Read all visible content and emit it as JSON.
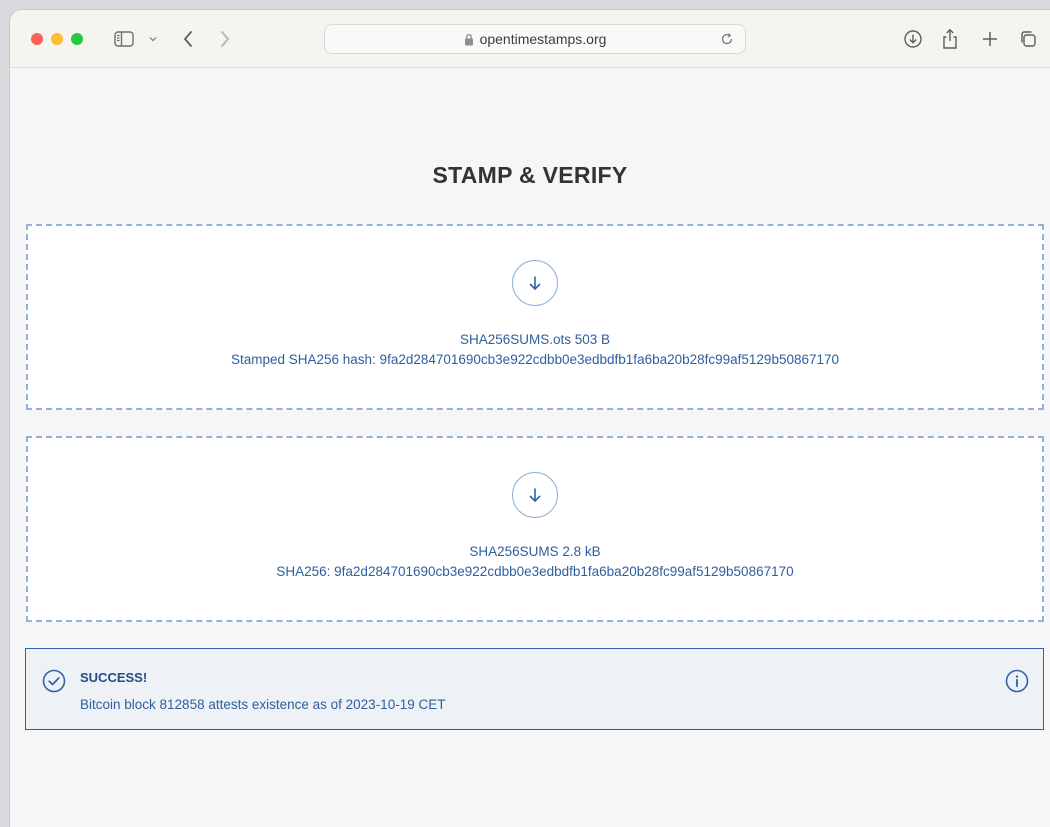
{
  "browser": {
    "url_host": "opentimestamps.org"
  },
  "page": {
    "title": "STAMP & VERIFY"
  },
  "dropzones": [
    {
      "line1": "SHA256SUMS.ots 503 B",
      "line2": "Stamped SHA256 hash: 9fa2d284701690cb3e922cdbb0e3edbdfb1fa6ba20b28fc99af5129b50867170"
    },
    {
      "line1": "SHA256SUMS 2.8 kB",
      "line2": "SHA256: 9fa2d284701690cb3e922cdbb0e3edbdfb1fa6ba20b28fc99af5129b50867170"
    }
  ],
  "result": {
    "status": "SUCCESS!",
    "message": "Bitcoin block 812858 attests existence as of 2023-10-19 CET"
  },
  "colors": {
    "accent": "#2f62a7",
    "text_link": "#2d5fa0",
    "dash_border": "#92b2d6"
  },
  "icons": [
    "sidebar-icon",
    "chevron-down-icon",
    "back-icon",
    "forward-icon",
    "lock-icon",
    "reload-icon",
    "download-icon",
    "share-icon",
    "plus-icon",
    "tabs-icon",
    "arrow-down-icon",
    "check-circle-icon",
    "info-icon"
  ]
}
